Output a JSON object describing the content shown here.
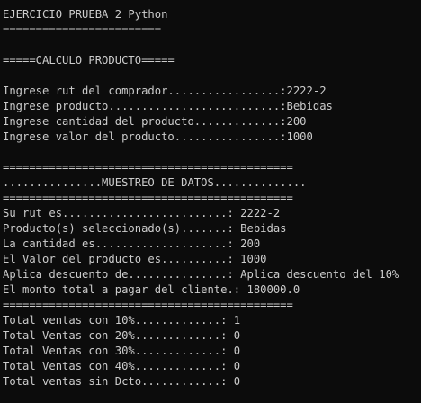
{
  "console": {
    "lines": [
      "EJERCICIO PRUEBA 2 Python",
      "========================",
      "",
      "=====CALCULO PRODUCTO=====",
      "",
      "Ingrese rut del comprador.................:2222-2",
      "Ingrese producto..........................:Bebidas",
      "Ingrese cantidad del producto.............:200",
      "Ingrese valor del producto................:1000",
      "",
      "============================================",
      "...............MUESTREO DE DATOS..............",
      "============================================",
      "Su rut es.........................: 2222-2",
      "Producto(s) seleccionado(s).......: Bebidas",
      "La cantidad es....................: 200",
      "El Valor del producto es..........: 1000",
      "Aplica descuento de...............: Aplica descuento del 10%",
      "El monto total a pagar del cliente.: 180000.0",
      "============================================",
      "Total ventas con 10%.............: 1",
      "Total Ventas con 20%.............: 0",
      "Total Ventas con 30%.............: 0",
      "Total Ventas con 40%.............: 0",
      "Total ventas sin Dcto............: 0"
    ]
  }
}
